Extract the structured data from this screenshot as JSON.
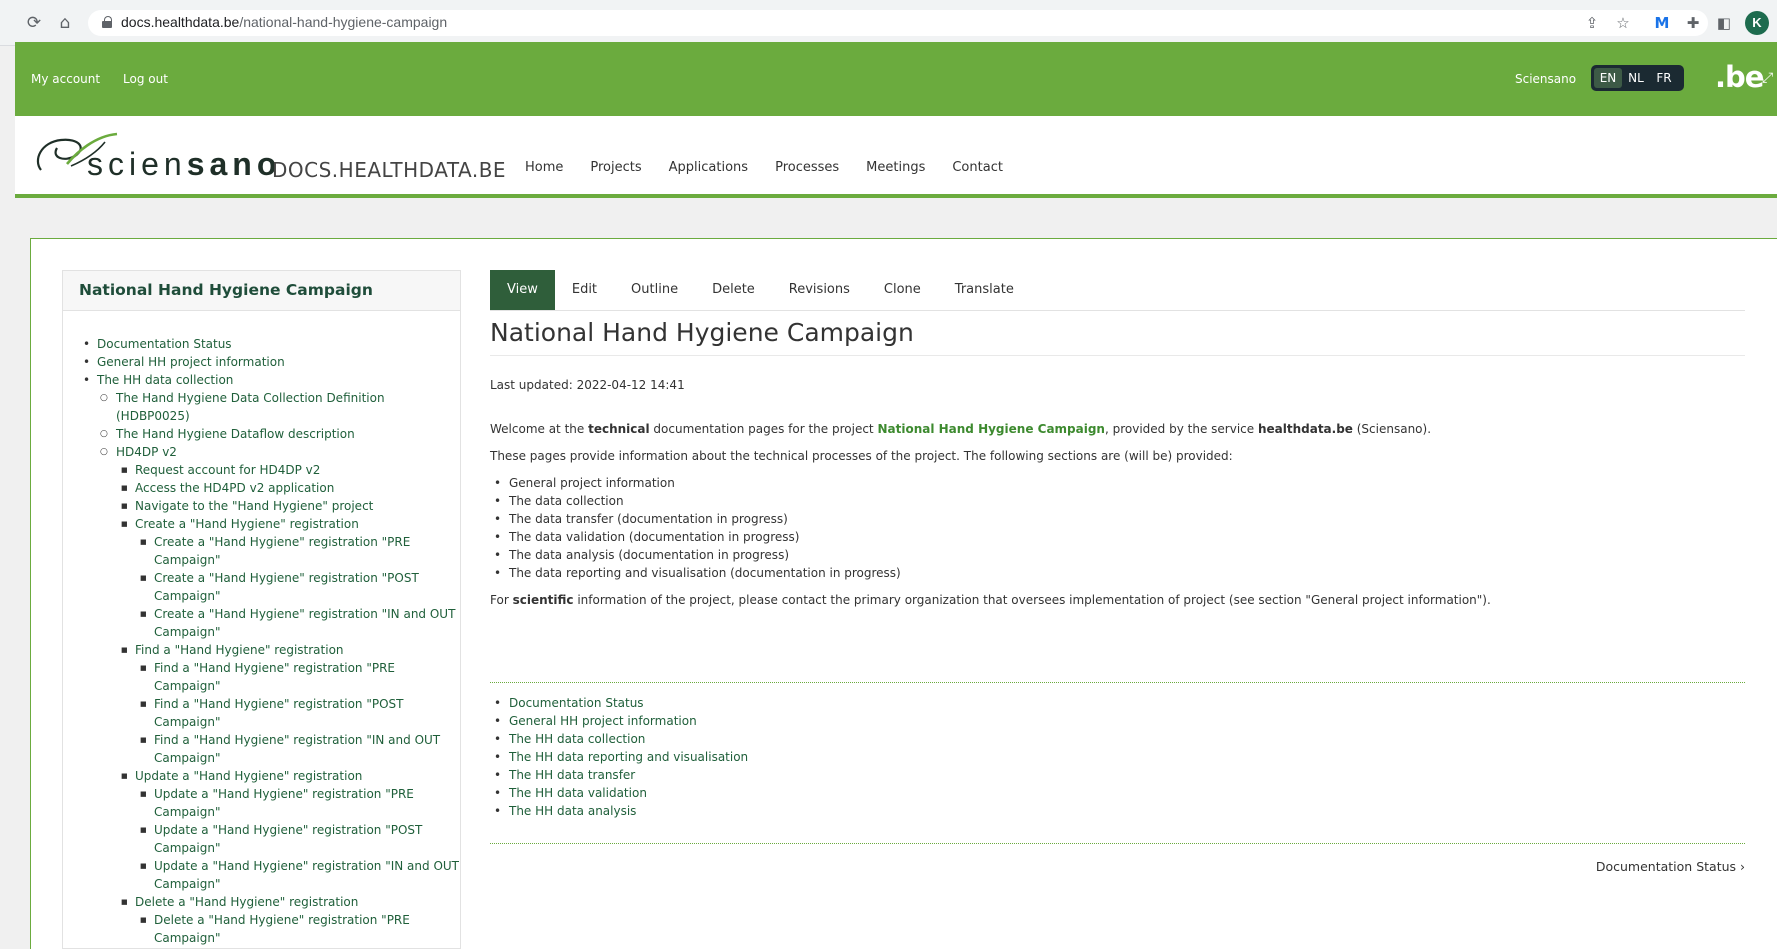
{
  "browser": {
    "url_domain": "docs.healthdata.be",
    "url_path": "/national-hand-hygiene-campaign",
    "profile_initial": "K"
  },
  "topbar": {
    "my_account": "My account",
    "log_out": "Log out",
    "org": "Sciensano",
    "languages": [
      "EN",
      "NL",
      "FR"
    ],
    "active_language": "EN",
    "be_logo": ".be"
  },
  "header": {
    "logo_text_light": "scien",
    "logo_text_bold": "sano",
    "site_title": "DOCS.HEALTHDATA.BE",
    "nav": [
      "Home",
      "Projects",
      "Applications",
      "Processes",
      "Meetings",
      "Contact"
    ]
  },
  "sidebar": {
    "title": "National Hand Hygiene Campaign",
    "items": [
      {
        "level": 1,
        "label": "Documentation Status"
      },
      {
        "level": 1,
        "label": "General HH project information"
      },
      {
        "level": 1,
        "label": "The HH data collection"
      },
      {
        "level": 2,
        "label": "The Hand Hygiene Data Collection Definition (HDBP0025)"
      },
      {
        "level": 2,
        "label": "The Hand Hygiene Dataflow description"
      },
      {
        "level": 2,
        "label": "HD4DP v2"
      },
      {
        "level": 3,
        "label": "Request account for HD4DP v2"
      },
      {
        "level": 3,
        "label": "Access the HD4PD v2 application"
      },
      {
        "level": 3,
        "label": "Navigate to the \"Hand Hygiene\" project"
      },
      {
        "level": 3,
        "label": "Create a \"Hand Hygiene\" registration"
      },
      {
        "level": 4,
        "label": "Create a \"Hand Hygiene\" registration \"PRE Campaign\""
      },
      {
        "level": 4,
        "label": "Create a \"Hand Hygiene\" registration \"POST Campaign\""
      },
      {
        "level": 4,
        "label": "Create a \"Hand Hygiene\" registration \"IN and OUT Campaign\""
      },
      {
        "level": 3,
        "label": "Find a \"Hand Hygiene\" registration"
      },
      {
        "level": 4,
        "label": "Find a \"Hand Hygiene\" registration \"PRE Campaign\""
      },
      {
        "level": 4,
        "label": "Find a \"Hand Hygiene\" registration \"POST Campaign\""
      },
      {
        "level": 4,
        "label": "Find a \"Hand Hygiene\" registration \"IN and OUT Campaign\""
      },
      {
        "level": 3,
        "label": "Update a \"Hand Hygiene\" registration"
      },
      {
        "level": 4,
        "label": "Update a \"Hand Hygiene\" registration \"PRE Campaign\""
      },
      {
        "level": 4,
        "label": "Update a \"Hand Hygiene\" registration \"POST Campaign\""
      },
      {
        "level": 4,
        "label": "Update a \"Hand Hygiene\" registration \"IN and OUT Campaign\""
      },
      {
        "level": 3,
        "label": "Delete a \"Hand Hygiene\" registration"
      },
      {
        "level": 4,
        "label": "Delete a \"Hand Hygiene\" registration \"PRE Campaign\""
      }
    ]
  },
  "tabs": [
    "View",
    "Edit",
    "Outline",
    "Delete",
    "Revisions",
    "Clone",
    "Translate"
  ],
  "active_tab": "View",
  "content": {
    "title": "National Hand Hygiene Campaign",
    "last_updated": "Last updated: 2022-04-12 14:41",
    "intro_1": "Welcome at the ",
    "intro_bold_1": "technical",
    "intro_2": " documentation pages for the project ",
    "intro_project": "National Hand Hygiene Campaign",
    "intro_3": ", provided by the service ",
    "intro_service": "healthdata.be",
    "intro_4": " (Sciensano).",
    "sections_intro": "These pages provide information about the technical processes of the project. The following sections are (will be) provided:",
    "sections": [
      "General project information",
      "The data collection",
      "The data transfer (documentation in progress)",
      "The data validation (documentation in progress)",
      "The data analysis (documentation in progress)",
      "The data reporting and visualisation (documentation in progress)"
    ],
    "scientific_1": "For ",
    "scientific_bold": "scientific",
    "scientific_2": " information of the project, please contact the primary organization that oversees implementation of project (see section \"General project information\").",
    "child_pages": [
      "Documentation Status",
      "General HH project information",
      "The HH data collection",
      "The HH data reporting and visualisation",
      "The HH data transfer",
      "The HH data validation",
      "The HH data analysis"
    ],
    "next_link": "Documentation Status ›"
  },
  "colors": {
    "brand_green": "#6bab3e",
    "dark_green": "#2f5e3a",
    "link_green": "#1f5f3a"
  }
}
